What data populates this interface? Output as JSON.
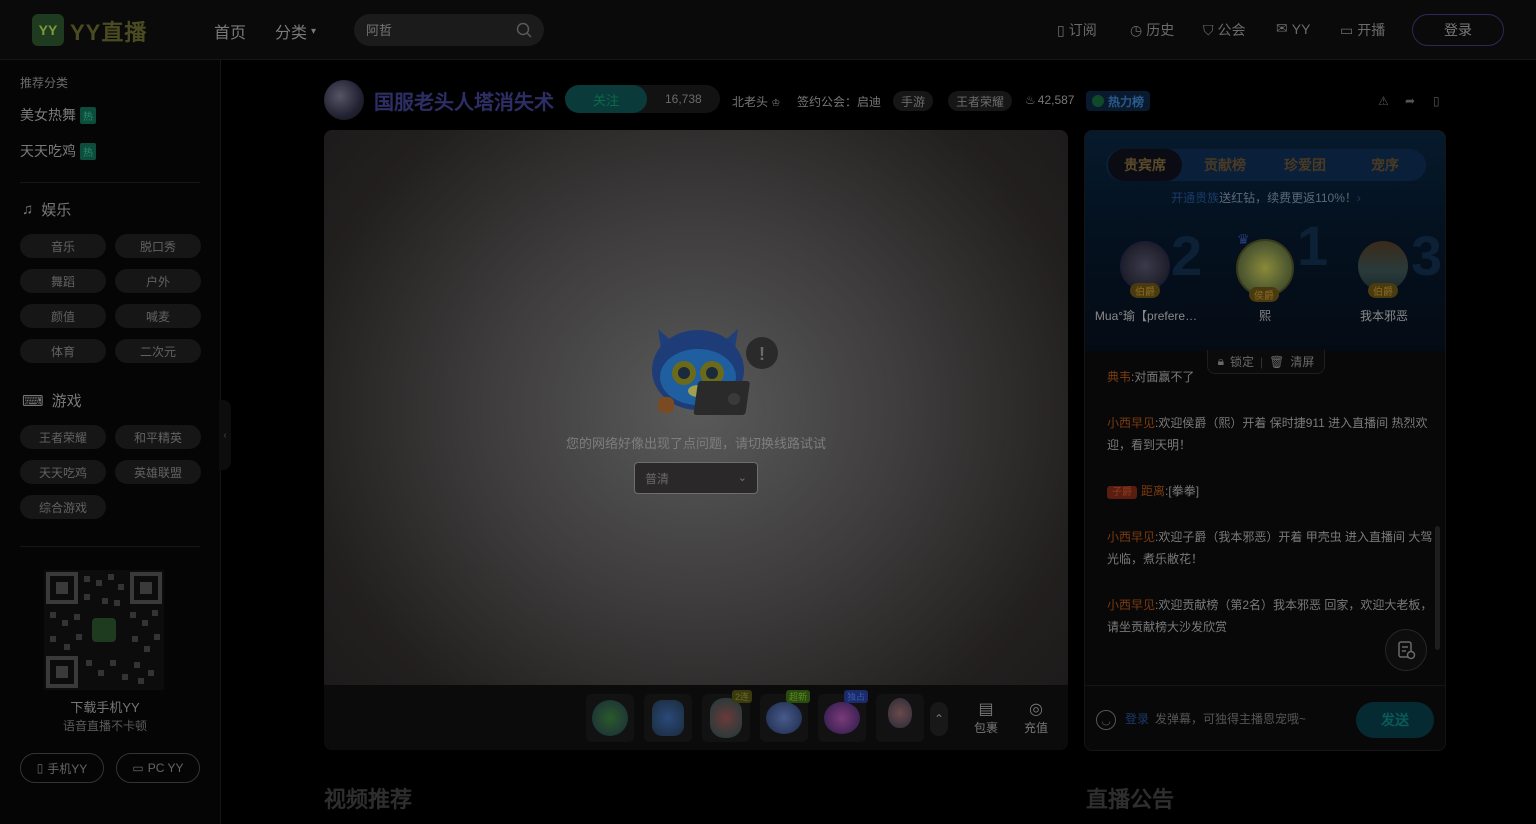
{
  "header": {
    "logo_text": "YY直播",
    "nav": {
      "home": "首页",
      "category": "分类"
    },
    "search_placeholder": "阿哲",
    "items": {
      "subscribe": "订阅",
      "history": "历史",
      "guild": "公会",
      "yy": "YY",
      "live": "开播"
    },
    "login": "登录"
  },
  "sidebar": {
    "rec_label": "推荐分类",
    "rec_items": [
      {
        "label": "美女热舞",
        "badge": "热"
      },
      {
        "label": "天天吃鸡",
        "badge": "热"
      }
    ],
    "ent_title": "娱乐",
    "ent_chips": [
      "音乐",
      "脱口秀",
      "舞蹈",
      "户外",
      "颜值",
      "喊麦",
      "体育",
      "二次元"
    ],
    "game_title": "游戏",
    "game_chips": [
      "王者荣耀",
      "和平精英",
      "天天吃鸡",
      "英雄联盟",
      "综合游戏"
    ],
    "download_title": "下载手机YY",
    "download_sub": "语音直播不卡顿",
    "btn_mobile": "手机YY",
    "btn_pc": "PC YY"
  },
  "room": {
    "title": "国服老头人塔消失术",
    "follow": "关注",
    "follow_count": "16,738",
    "anchor": "北老头",
    "guild": "签约公会：启迪",
    "tag1": "手游",
    "tag2": "王者荣耀",
    "heat": "42,587",
    "heat_rank": "热力榜"
  },
  "player": {
    "error": "您的网络好像出现了点问题，请切换线路试试",
    "line_select": "普清",
    "gifts": [
      {
        "name": "gift-1",
        "color": "#1b3a1b",
        "badge": ""
      },
      {
        "name": "gift-2",
        "color": "#1b2a3a",
        "badge": ""
      },
      {
        "name": "gift-3",
        "color": "#2a1e1e",
        "badge": "2连"
      },
      {
        "name": "gift-4",
        "color": "#14213a",
        "badge": "超新"
      },
      {
        "name": "gift-5",
        "color": "#2a1a3a",
        "badge": "独占"
      },
      {
        "name": "gift-6",
        "color": "#1a1a2a",
        "badge": ""
      }
    ],
    "bag": "包裹",
    "recharge": "充值"
  },
  "panel": {
    "tabs": [
      "贵宾席",
      "贡献榜",
      "珍爱团",
      "宠序"
    ],
    "vip_link": "开通贵族",
    "vip_tip": "送红钻，续费更返110%！",
    "ranks": [
      {
        "pos": "2",
        "name": "Mua°瑜【prefere…",
        "title": "伯爵"
      },
      {
        "pos": "1",
        "name": "熙",
        "title": "侯爵"
      },
      {
        "pos": "3",
        "name": "我本邪恶",
        "title": "伯爵"
      }
    ],
    "lock": "锁定",
    "clear": "清屏",
    "messages": [
      {
        "tag": "",
        "nick": "典韦",
        "text": "对面赢不了"
      },
      {
        "tag": "",
        "nick": "小西早见",
        "text": "欢迎侯爵（熙）开着 保时捷911 进入直播间 热烈欢迎，看到天明！"
      },
      {
        "tag": "子爵",
        "nick": "距离",
        "text": "[拳拳]"
      },
      {
        "tag": "",
        "nick": "小西早见",
        "text": "欢迎子爵（我本邪恶）开着 甲壳虫 进入直播间 大驾光临，煮乐敝花！"
      },
      {
        "tag": "",
        "nick": "小西早见",
        "text": "欢迎贡献榜（第2名）我本邪恶 回家，欢迎大老板，请坐贡献榜大沙发欣赏"
      }
    ],
    "input_login": "登录",
    "input_placeholder": "发弹幕，可独得主播恩宠哦~",
    "send": "发送"
  },
  "sections": {
    "videos": "视频推荐",
    "notice": "直播公告"
  }
}
